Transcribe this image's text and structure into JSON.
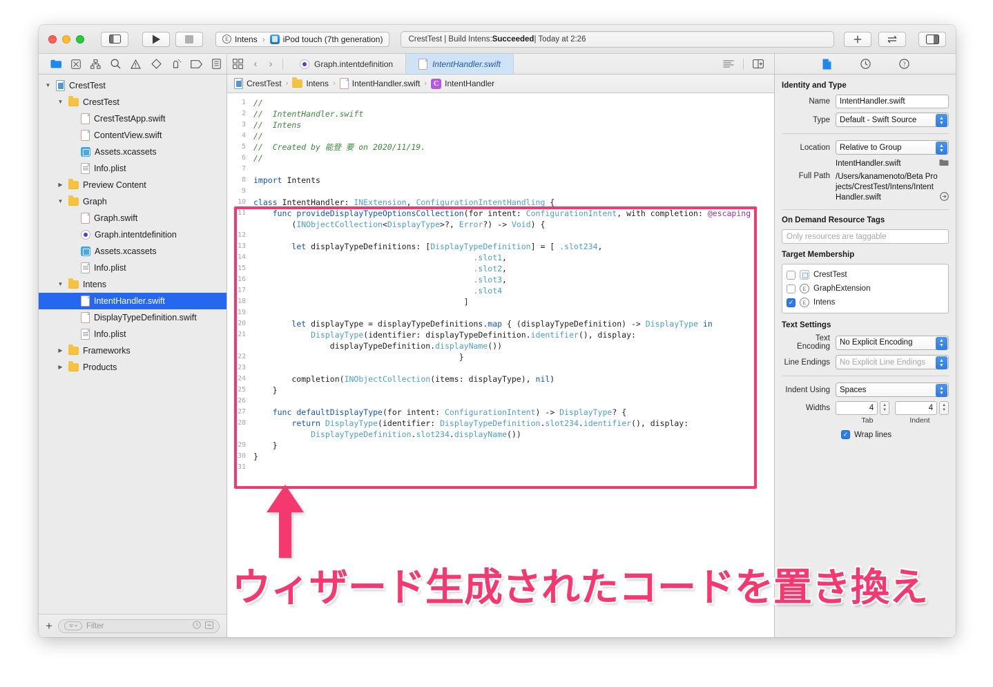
{
  "titlebar": {
    "scheme_badge": "E",
    "scheme_name": "Intens",
    "scheme_sep": "›",
    "destination": "iPod touch (7th generation)",
    "status_prefix": "CrestTest | Build Intens: ",
    "status_result": "Succeeded",
    "status_suffix": " | Today at 2:26",
    "run_label": "▶",
    "stop_label": "■",
    "add_label": "+",
    "swap_label": "⇄"
  },
  "navigator_toolbar": {
    "icons": [
      "folder-icon",
      "issue-icon",
      "hierarchy-icon",
      "search-icon",
      "warning-icon",
      "test-icon",
      "debug-icon",
      "breakpoint-icon",
      "report-icon"
    ]
  },
  "tabs": {
    "items": [
      {
        "label": "Graph.intentdefinition",
        "icon": "intentdefinition-icon",
        "active": false
      },
      {
        "label": "IntentHandler.swift",
        "icon": "swift-file-icon",
        "active": true
      }
    ]
  },
  "navigator": {
    "tree": [
      {
        "indent": 0,
        "tri": "open",
        "icon": "project-icon",
        "label": "CrestTest",
        "selected": false
      },
      {
        "indent": 1,
        "tri": "open",
        "icon": "folder-icon",
        "label": "CrestTest",
        "selected": false
      },
      {
        "indent": 2,
        "tri": "none",
        "icon": "swift-icon",
        "label": "CrestTestApp.swift",
        "selected": false
      },
      {
        "indent": 2,
        "tri": "none",
        "icon": "swift-icon",
        "label": "ContentView.swift",
        "selected": false
      },
      {
        "indent": 2,
        "tri": "none",
        "icon": "assets-icon",
        "label": "Assets.xcassets",
        "selected": false
      },
      {
        "indent": 2,
        "tri": "none",
        "icon": "plist-icon",
        "label": "Info.plist",
        "selected": false
      },
      {
        "indent": 1,
        "tri": "closed",
        "icon": "folder-icon",
        "label": "Preview Content",
        "selected": false
      },
      {
        "indent": 1,
        "tri": "open",
        "icon": "folder-icon",
        "label": "Graph",
        "selected": false
      },
      {
        "indent": 2,
        "tri": "none",
        "icon": "swift-icon",
        "label": "Graph.swift",
        "selected": false
      },
      {
        "indent": 2,
        "tri": "none",
        "icon": "intent-icon",
        "label": "Graph.intentdefinition",
        "selected": false
      },
      {
        "indent": 2,
        "tri": "none",
        "icon": "assets-icon",
        "label": "Assets.xcassets",
        "selected": false
      },
      {
        "indent": 2,
        "tri": "none",
        "icon": "plist-icon",
        "label": "Info.plist",
        "selected": false
      },
      {
        "indent": 1,
        "tri": "open",
        "icon": "folder-icon",
        "label": "Intens",
        "selected": false
      },
      {
        "indent": 2,
        "tri": "none",
        "icon": "swift-icon",
        "label": "IntentHandler.swift",
        "selected": true
      },
      {
        "indent": 2,
        "tri": "none",
        "icon": "swift-icon",
        "label": "DisplayTypeDefinition.swift",
        "selected": false
      },
      {
        "indent": 2,
        "tri": "none",
        "icon": "plist-icon",
        "label": "Info.plist",
        "selected": false
      },
      {
        "indent": 1,
        "tri": "closed",
        "icon": "folder-icon",
        "label": "Frameworks",
        "selected": false
      },
      {
        "indent": 1,
        "tri": "closed",
        "icon": "folder-icon",
        "label": "Products",
        "selected": false
      }
    ],
    "footer": {
      "add_label": "+",
      "filter_placeholder": "Filter"
    }
  },
  "jumpbar": {
    "crumbs": [
      "CrestTest",
      "Intens",
      "IntentHandler.swift",
      "IntentHandler"
    ],
    "sep": "›"
  },
  "code": {
    "first_line_number": 1,
    "lines": [
      {
        "n": 1,
        "tokens": [
          {
            "t": "//",
            "c": "cm"
          }
        ]
      },
      {
        "n": 2,
        "tokens": [
          {
            "t": "//  IntentHandler.swift",
            "c": "cm"
          }
        ]
      },
      {
        "n": 3,
        "tokens": [
          {
            "t": "//  Intens",
            "c": "cm"
          }
        ]
      },
      {
        "n": 4,
        "tokens": [
          {
            "t": "//",
            "c": "cm"
          }
        ]
      },
      {
        "n": 5,
        "tokens": [
          {
            "t": "//  Created by 能登 要 on 2020/11/19.",
            "c": "cm"
          }
        ]
      },
      {
        "n": 6,
        "tokens": [
          {
            "t": "//",
            "c": "cm"
          }
        ]
      },
      {
        "n": 7,
        "tokens": [
          {
            "t": "",
            "c": "pl"
          }
        ]
      },
      {
        "n": 8,
        "tokens": [
          {
            "t": "import",
            "c": "kb"
          },
          {
            "t": " Intents",
            "c": "pl"
          }
        ]
      },
      {
        "n": 9,
        "tokens": [
          {
            "t": "",
            "c": "pl"
          }
        ]
      },
      {
        "n": 10,
        "tokens": [
          {
            "t": "class",
            "c": "kb"
          },
          {
            "t": " IntentHandler: ",
            "c": "pl"
          },
          {
            "t": "INExtension",
            "c": "t"
          },
          {
            "t": ", ",
            "c": "pl"
          },
          {
            "t": "ConfigurationIntentHandling",
            "c": "t"
          },
          {
            "t": " {",
            "c": "pl"
          }
        ]
      },
      {
        "n": 11,
        "tokens": [
          {
            "t": "    ",
            "c": "pl"
          },
          {
            "t": "func",
            "c": "kb"
          },
          {
            "t": " ",
            "c": "pl"
          },
          {
            "t": "provideDisplayTypeOptionsCollection",
            "c": "kb"
          },
          {
            "t": "(for intent: ",
            "c": "pl"
          },
          {
            "t": "ConfigurationIntent",
            "c": "t"
          },
          {
            "t": ", with completion: ",
            "c": "pl"
          },
          {
            "t": "@escaping",
            "c": "at"
          }
        ]
      },
      {
        "n": "",
        "tokens": [
          {
            "t": "        (",
            "c": "pl"
          },
          {
            "t": "INObjectCollection",
            "c": "t"
          },
          {
            "t": "<",
            "c": "pl"
          },
          {
            "t": "DisplayType",
            "c": "t"
          },
          {
            "t": ">?, ",
            "c": "pl"
          },
          {
            "t": "Error",
            "c": "t"
          },
          {
            "t": "?) -> ",
            "c": "pl"
          },
          {
            "t": "Void",
            "c": "t"
          },
          {
            "t": ") {",
            "c": "pl"
          }
        ]
      },
      {
        "n": 12,
        "tokens": [
          {
            "t": "",
            "c": "pl"
          }
        ]
      },
      {
        "n": 13,
        "tokens": [
          {
            "t": "        ",
            "c": "pl"
          },
          {
            "t": "let",
            "c": "kb"
          },
          {
            "t": " displayTypeDefinitions: [",
            "c": "pl"
          },
          {
            "t": "DisplayTypeDefinition",
            "c": "t"
          },
          {
            "t": "] = [ ",
            "c": "pl"
          },
          {
            "t": ".slot234",
            "c": "t"
          },
          {
            "t": ",",
            "c": "pl"
          }
        ]
      },
      {
        "n": 14,
        "tokens": [
          {
            "t": "                                              ",
            "c": "pl"
          },
          {
            "t": ".slot1",
            "c": "t"
          },
          {
            "t": ",",
            "c": "pl"
          }
        ]
      },
      {
        "n": 15,
        "tokens": [
          {
            "t": "                                              ",
            "c": "pl"
          },
          {
            "t": ".slot2",
            "c": "t"
          },
          {
            "t": ",",
            "c": "pl"
          }
        ]
      },
      {
        "n": 16,
        "tokens": [
          {
            "t": "                                              ",
            "c": "pl"
          },
          {
            "t": ".slot3",
            "c": "t"
          },
          {
            "t": ",",
            "c": "pl"
          }
        ]
      },
      {
        "n": 17,
        "tokens": [
          {
            "t": "                                              ",
            "c": "pl"
          },
          {
            "t": ".slot4",
            "c": "t"
          }
        ]
      },
      {
        "n": 18,
        "tokens": [
          {
            "t": "                                            ]",
            "c": "pl"
          }
        ]
      },
      {
        "n": 19,
        "tokens": [
          {
            "t": "",
            "c": "pl"
          }
        ]
      },
      {
        "n": 20,
        "tokens": [
          {
            "t": "        ",
            "c": "pl"
          },
          {
            "t": "let",
            "c": "kb"
          },
          {
            "t": " displayType = displayTypeDefinitions.",
            "c": "pl"
          },
          {
            "t": "map",
            "c": "kb"
          },
          {
            "t": " { (displayTypeDefinition) -> ",
            "c": "pl"
          },
          {
            "t": "DisplayType",
            "c": "t"
          },
          {
            "t": " ",
            "c": "pl"
          },
          {
            "t": "in",
            "c": "kb"
          }
        ]
      },
      {
        "n": 21,
        "tokens": [
          {
            "t": "            ",
            "c": "pl"
          },
          {
            "t": "DisplayType",
            "c": "t"
          },
          {
            "t": "(identifier: displayTypeDefinition.",
            "c": "pl"
          },
          {
            "t": "identifier",
            "c": "t"
          },
          {
            "t": "(), display:",
            "c": "pl"
          }
        ]
      },
      {
        "n": "",
        "tokens": [
          {
            "t": "                displayTypeDefinition.",
            "c": "pl"
          },
          {
            "t": "displayName",
            "c": "t"
          },
          {
            "t": "())",
            "c": "pl"
          }
        ]
      },
      {
        "n": 22,
        "tokens": [
          {
            "t": "                                           }",
            "c": "pl"
          }
        ]
      },
      {
        "n": 23,
        "tokens": [
          {
            "t": "",
            "c": "pl"
          }
        ]
      },
      {
        "n": 24,
        "tokens": [
          {
            "t": "        completion(",
            "c": "pl"
          },
          {
            "t": "INObjectCollection",
            "c": "t"
          },
          {
            "t": "(items: displayType), ",
            "c": "pl"
          },
          {
            "t": "nil",
            "c": "kb"
          },
          {
            "t": ")",
            "c": "pl"
          }
        ]
      },
      {
        "n": 25,
        "tokens": [
          {
            "t": "    }",
            "c": "pl"
          }
        ]
      },
      {
        "n": 26,
        "tokens": [
          {
            "t": "",
            "c": "pl"
          }
        ]
      },
      {
        "n": 27,
        "tokens": [
          {
            "t": "    ",
            "c": "pl"
          },
          {
            "t": "func",
            "c": "kb"
          },
          {
            "t": " ",
            "c": "pl"
          },
          {
            "t": "defaultDisplayType",
            "c": "kb"
          },
          {
            "t": "(for intent: ",
            "c": "pl"
          },
          {
            "t": "ConfigurationIntent",
            "c": "t"
          },
          {
            "t": ") -> ",
            "c": "pl"
          },
          {
            "t": "DisplayType",
            "c": "t"
          },
          {
            "t": "? {",
            "c": "pl"
          }
        ]
      },
      {
        "n": 28,
        "tokens": [
          {
            "t": "        ",
            "c": "pl"
          },
          {
            "t": "return",
            "c": "kb"
          },
          {
            "t": " ",
            "c": "pl"
          },
          {
            "t": "DisplayType",
            "c": "t"
          },
          {
            "t": "(identifier: ",
            "c": "pl"
          },
          {
            "t": "DisplayTypeDefinition",
            "c": "t"
          },
          {
            "t": ".",
            "c": "pl"
          },
          {
            "t": "slot234",
            "c": "t"
          },
          {
            "t": ".",
            "c": "pl"
          },
          {
            "t": "identifier",
            "c": "t"
          },
          {
            "t": "(), display:",
            "c": "pl"
          }
        ]
      },
      {
        "n": "",
        "tokens": [
          {
            "t": "            ",
            "c": "pl"
          },
          {
            "t": "DisplayTypeDefinition",
            "c": "t"
          },
          {
            "t": ".",
            "c": "pl"
          },
          {
            "t": "slot234",
            "c": "t"
          },
          {
            "t": ".",
            "c": "pl"
          },
          {
            "t": "displayName",
            "c": "t"
          },
          {
            "t": "())",
            "c": "pl"
          }
        ]
      },
      {
        "n": 29,
        "tokens": [
          {
            "t": "    }",
            "c": "pl"
          }
        ]
      },
      {
        "n": 30,
        "tokens": [
          {
            "t": "}",
            "c": "pl"
          }
        ]
      },
      {
        "n": 31,
        "tokens": [
          {
            "t": "",
            "c": "pl"
          }
        ]
      }
    ]
  },
  "inspector": {
    "tab_icons": [
      "file-inspector-icon",
      "history-inspector-icon",
      "quick-help-icon"
    ],
    "identity": {
      "title": "Identity and Type",
      "name_label": "Name",
      "name_value": "IntentHandler.swift",
      "type_label": "Type",
      "type_value": "Default - Swift Source",
      "location_label": "Location",
      "location_value": "Relative to Group",
      "location_file": "IntentHandler.swift",
      "fullpath_label": "Full Path",
      "fullpath_value": "/Users/kanamenoto/Beta Projects/CrestTest/Intens/IntentHandler.swift"
    },
    "odr": {
      "title": "On Demand Resource Tags",
      "placeholder": "Only resources are taggable"
    },
    "target_membership": {
      "title": "Target Membership",
      "items": [
        {
          "label": "CrestTest",
          "checked": false,
          "kind": "app"
        },
        {
          "label": "GraphExtension",
          "checked": false,
          "kind": "ext"
        },
        {
          "label": "Intens",
          "checked": true,
          "kind": "ext"
        }
      ]
    },
    "text_settings": {
      "title": "Text Settings",
      "encoding_label": "Text Encoding",
      "encoding_value": "No Explicit Encoding",
      "line_endings_label": "Line Endings",
      "line_endings_value": "No Explicit Line Endings",
      "indent_label": "Indent Using",
      "indent_value": "Spaces",
      "widths_label": "Widths",
      "tab_width": "4",
      "indent_width": "4",
      "tab_caption": "Tab",
      "indent_caption": "Indent",
      "wrap_label": "Wrap lines",
      "wrap_checked": true
    }
  },
  "annotation": {
    "text": "ウィザード生成されたコードを置き換え",
    "color": "#f5386f",
    "arrow": "up-arrow-icon"
  }
}
